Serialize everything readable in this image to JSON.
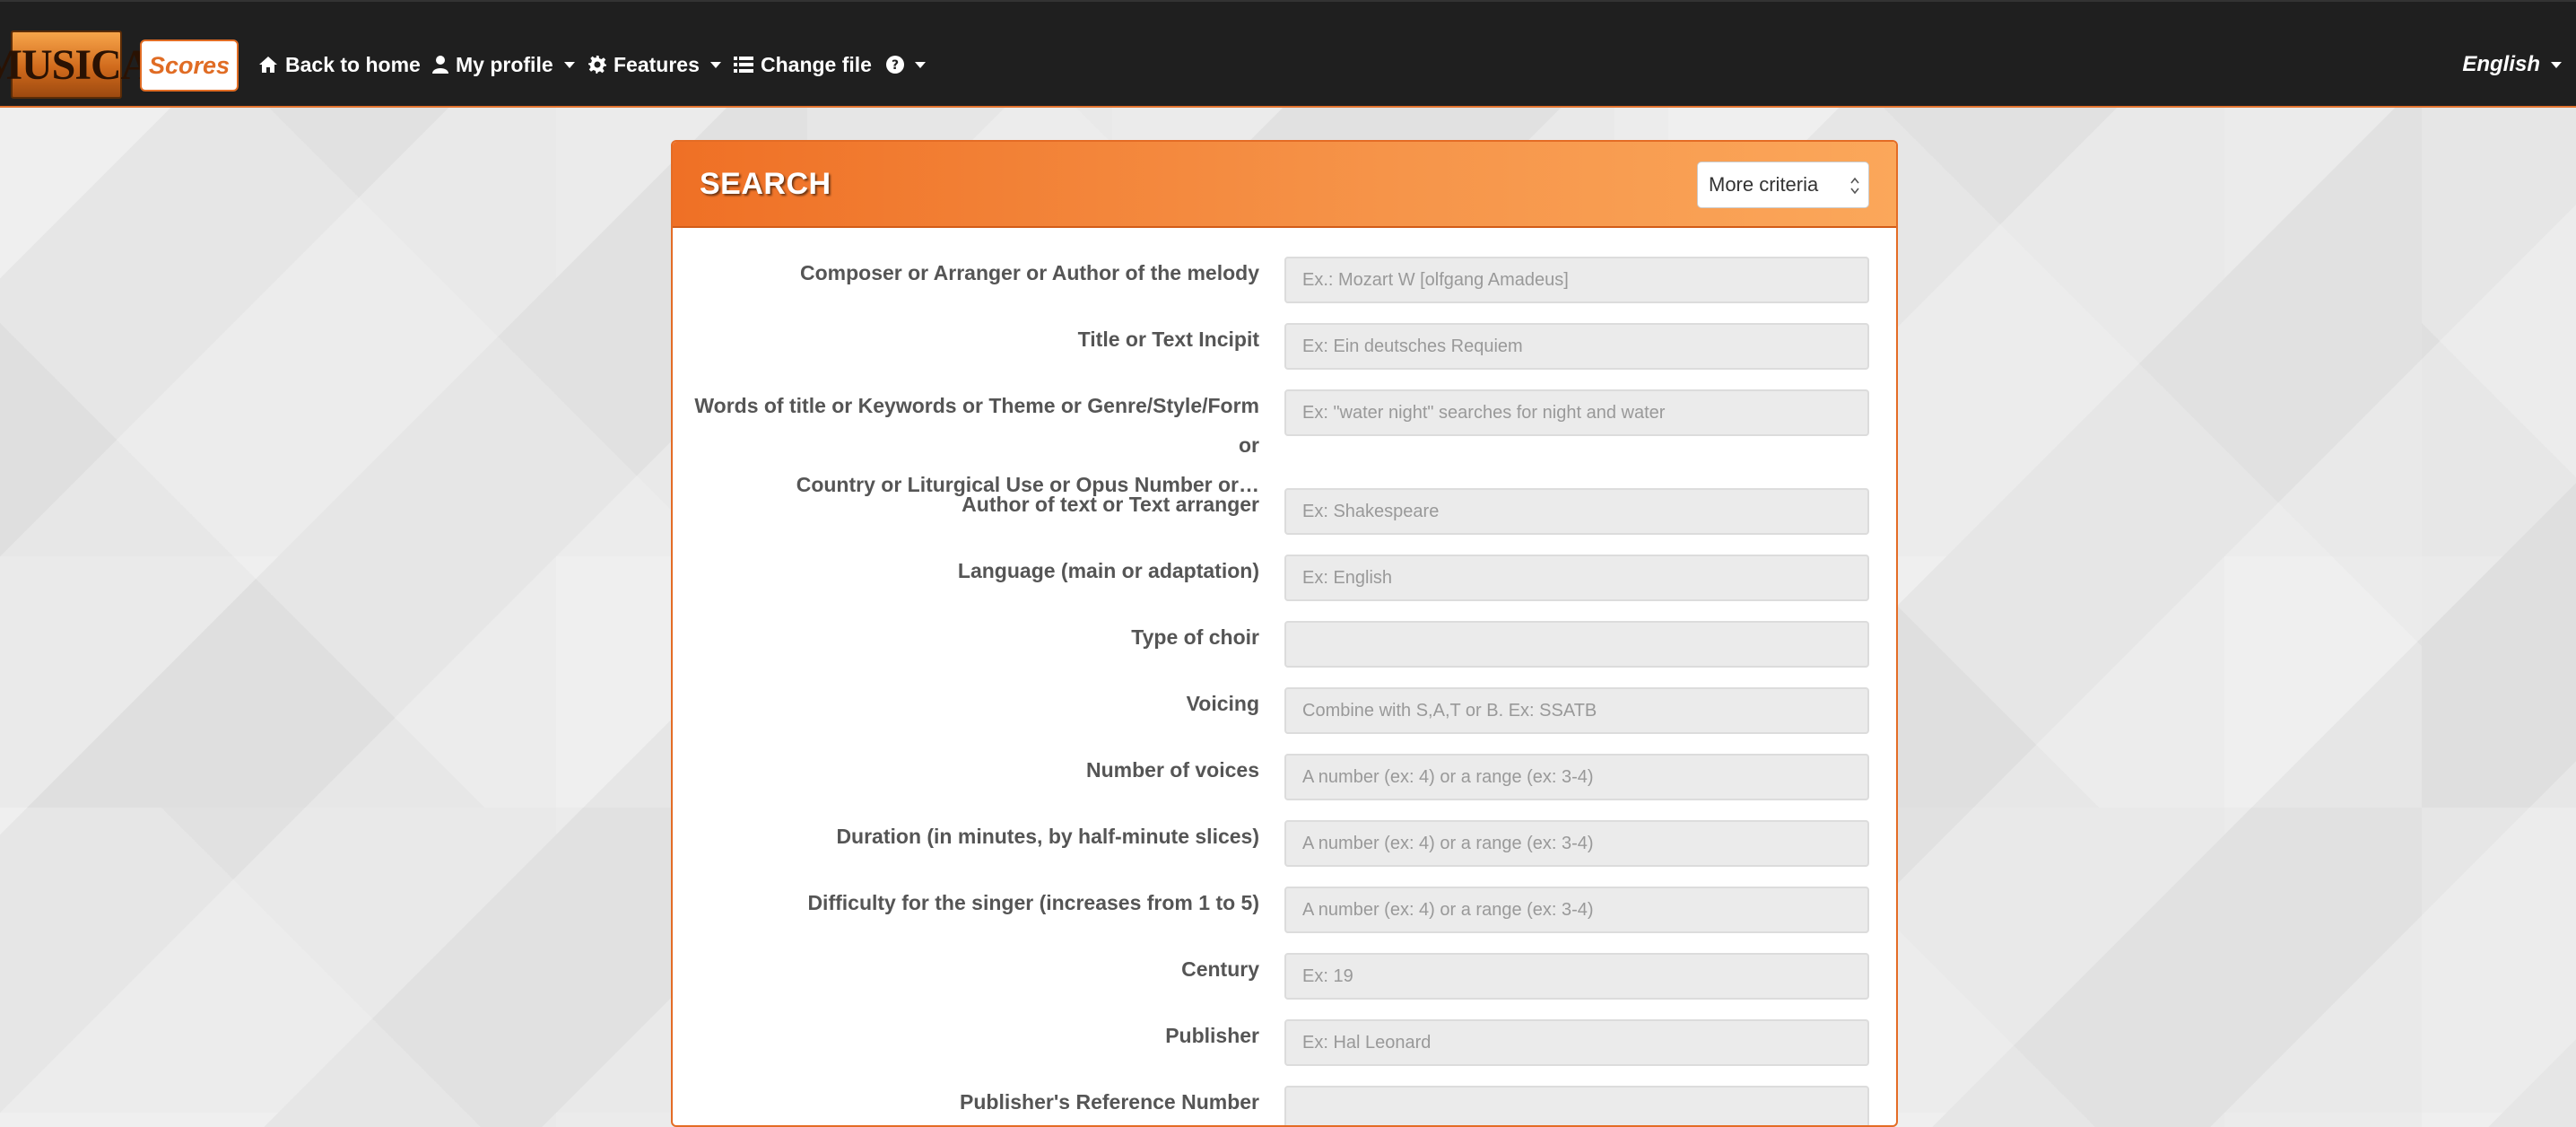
{
  "nav": {
    "logo": "MUSICA",
    "scores": "Scores",
    "home": "Back to home",
    "profile": "My profile",
    "features": "Features",
    "change_file": "Change file",
    "language": "English"
  },
  "search": {
    "title": "SEARCH",
    "criteria_select": "More criteria",
    "fields": [
      {
        "label": "Composer or Arranger or Author of the melody",
        "placeholder": "Ex.: Mozart W [olfgang Amadeus]"
      },
      {
        "label": "Title or Text Incipit",
        "placeholder": "Ex: Ein deutsches Requiem"
      },
      {
        "label_line1": "Words of title or Keywords or Theme or Genre/Style/Form or",
        "label_line2": "Country or Liturgical Use or Opus Number or…",
        "placeholder": "Ex: \"water night\" searches for night and water"
      },
      {
        "label": "Author of text or Text arranger",
        "placeholder": "Ex: Shakespeare"
      },
      {
        "label": "Language (main or adaptation)",
        "placeholder": "Ex: English"
      },
      {
        "label": "Type of choir",
        "placeholder": ""
      },
      {
        "label": "Voicing",
        "placeholder": "Combine with S,A,T or B. Ex: SSATB"
      },
      {
        "label": "Number of voices",
        "placeholder": "A number (ex: 4) or a range (ex: 3-4)"
      },
      {
        "label": "Duration (in minutes, by half-minute slices)",
        "placeholder": "A number (ex: 4) or a range (ex: 3-4)"
      },
      {
        "label": "Difficulty for the singer (increases from 1 to 5)",
        "placeholder": "A number (ex: 4) or a range (ex: 3-4)"
      },
      {
        "label": "Century",
        "placeholder": "Ex: 19"
      },
      {
        "label": "Publisher",
        "placeholder": "Ex: Hal Leonard"
      },
      {
        "label": "Publisher's Reference Number",
        "placeholder": ""
      }
    ]
  },
  "colors": {
    "accent": "#ef7025",
    "navbar": "#1f1f1f"
  },
  "icons": [
    "home-icon",
    "user-icon",
    "gear-icon",
    "list-icon",
    "help-icon"
  ]
}
